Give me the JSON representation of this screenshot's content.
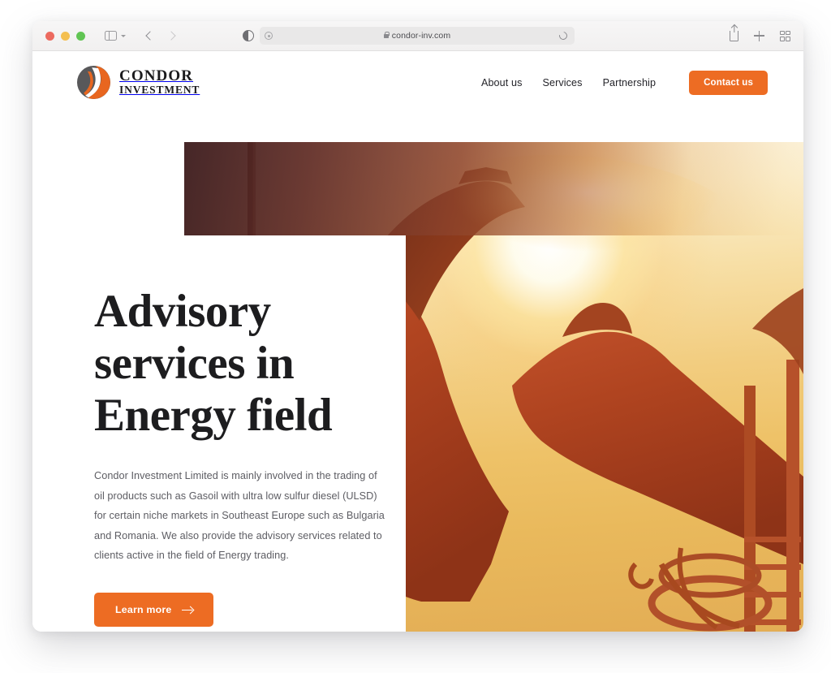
{
  "browser": {
    "url": "condor-inv.com",
    "secure": true,
    "traffic_lights": [
      "close",
      "minimize",
      "maximize"
    ],
    "toolbar_icons": [
      "sidebar-icon",
      "chevron-down-icon",
      "back-arrow-icon",
      "forward-arrow-icon",
      "contrast-icon",
      "lock-icon",
      "reload-icon",
      "share-icon",
      "new-tab-icon",
      "tab-overview-icon"
    ]
  },
  "site": {
    "logo": {
      "mark": "condor-flame-logo-icon",
      "line1": "CONDOR",
      "line2": "INVESTMENT"
    },
    "nav": {
      "links": [
        {
          "label": "About us"
        },
        {
          "label": "Services"
        },
        {
          "label": "Partnership"
        }
      ],
      "cta": {
        "label": "Contact us"
      }
    },
    "hero": {
      "title": "Advisory services in Energy field",
      "paragraph": "Condor Investment Limited is mainly involved in the trading of oil products such as Gasoil with ultra low sulfur diesel (ULSD) for certain niche markets in Southeast Europe such as Bulgaria and Romania. We also provide the advisory services related to clients active in the field of Energy trading.",
      "cta": {
        "label": "Learn more",
        "icon": "arrow-right-icon"
      },
      "image_alt": "oil-pumpjack-at-sunset-photo"
    }
  },
  "colors": {
    "accent_orange": "#ed6c23",
    "heading_dark": "#1d1d1f",
    "body_text": "#5d5d63",
    "sky_light": "#fdf6e8",
    "sky_deep": "#e3ad55",
    "silhouette": "#a8431f"
  }
}
